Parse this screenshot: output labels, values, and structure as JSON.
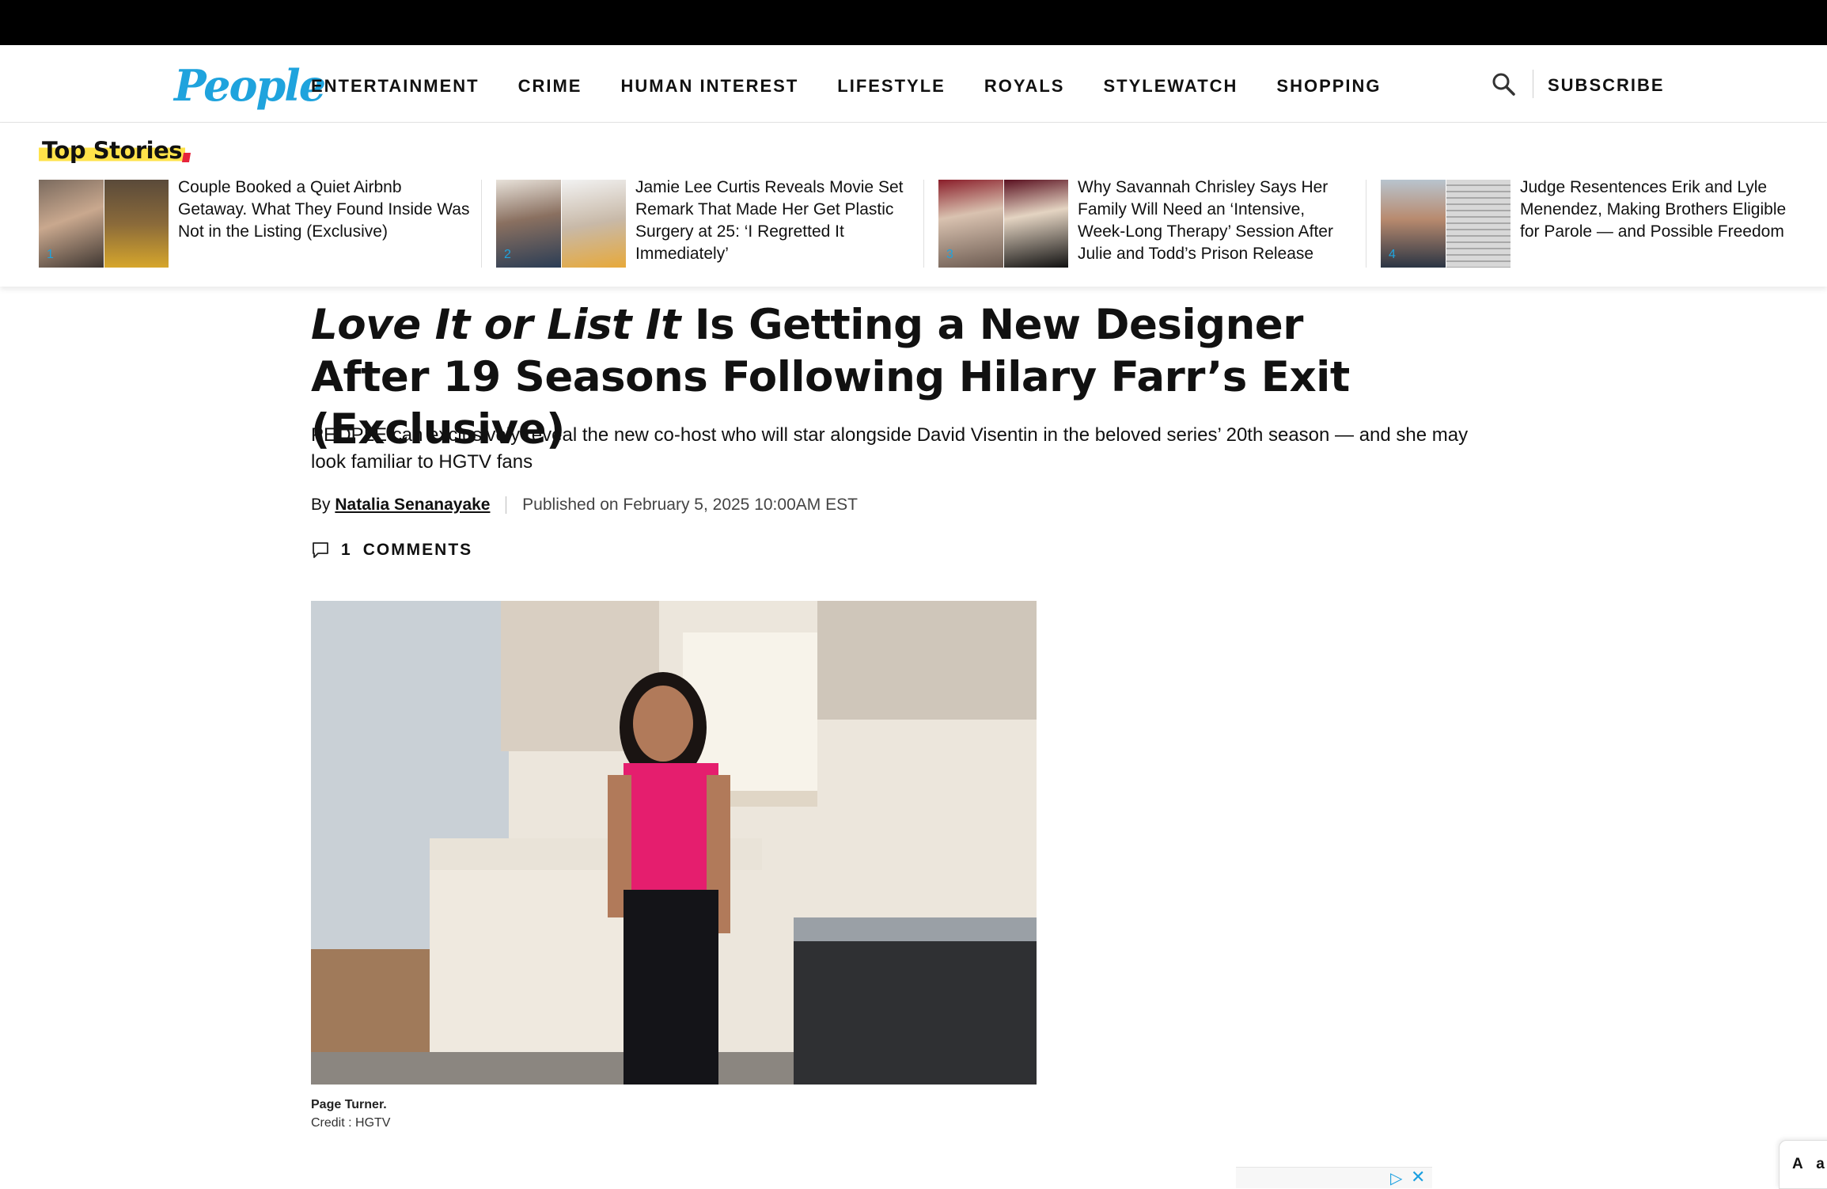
{
  "site": {
    "logo_text": "People",
    "nav": [
      "ENTERTAINMENT",
      "CRIME",
      "HUMAN INTEREST",
      "LIFESTYLE",
      "ROYALS",
      "STYLEWATCH",
      "SHOPPING"
    ],
    "subscribe_label": "SUBSCRIBE",
    "brand_color": "#1fa3dd"
  },
  "top_stories": {
    "title": "Top Stories",
    "items": [
      {
        "num": "1",
        "text": "Couple Booked a Quiet Airbnb Getaway. What They Found Inside Was Not in the Listing (Exclusive)"
      },
      {
        "num": "2",
        "text": "Jamie Lee Curtis Reveals Movie Set Remark That Made Her Get Plastic Surgery at 25: ‘I Regretted It Immediately’"
      },
      {
        "num": "3",
        "text": "Why Savannah Chrisley Says Her Family Will Need an ‘Intensive, Week-Long Therapy’ Session After Julie and Todd’s Prison Release"
      },
      {
        "num": "4",
        "text": "Judge Resentences Erik and Lyle Menendez, Making Brothers Eligible for Parole — and Possible Freedom"
      }
    ]
  },
  "article": {
    "headline_italic": "Love It or List It",
    "headline_rest": " Is Getting a New Designer After 19 Seasons Following Hilary Farr’s Exit (Exclusive)",
    "dek": "PEOPLE can exclusively reveal the new co-host who will star alongside David Visentin in the beloved series’ 20th season — and she may look familiar to HGTV fans",
    "by_label": "By",
    "author": "Natalia Senanayake",
    "published": "Published on February 5, 2025 10:00AM EST",
    "comments_count": "1",
    "comments_label": "COMMENTS",
    "caption_title": "Page Turner.",
    "caption_credit": "Credit : HGTV"
  },
  "widgets": {
    "font_size_label": "A a"
  }
}
